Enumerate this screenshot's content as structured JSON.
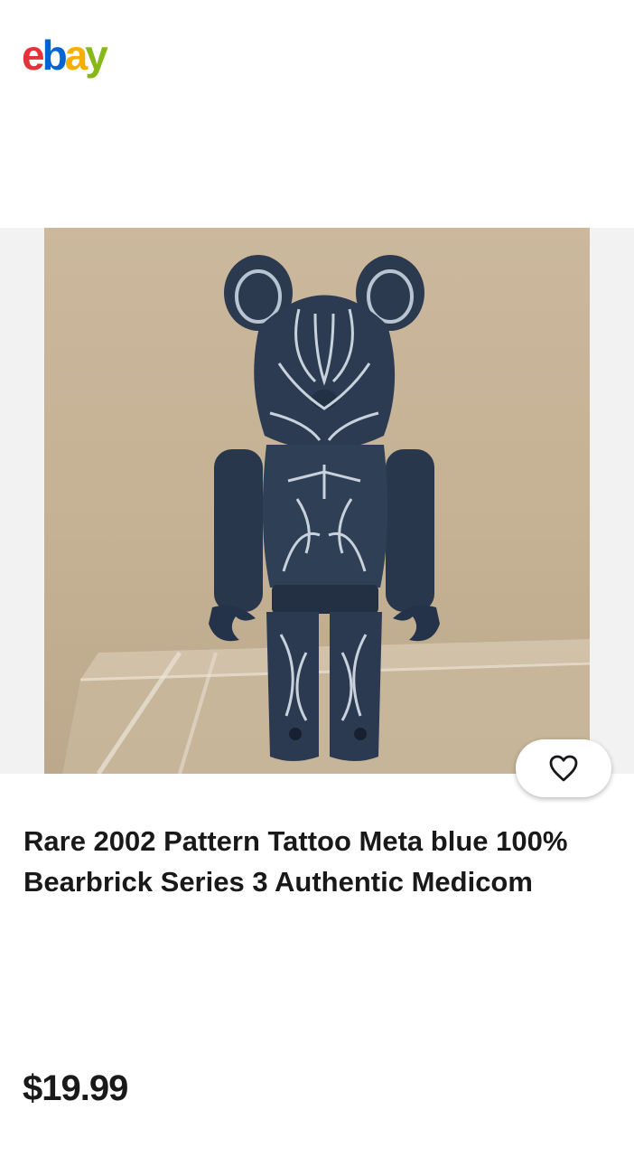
{
  "brand": {
    "logo_letters": [
      "e",
      "b",
      "a",
      "y"
    ],
    "colors": {
      "e": "#e53238",
      "b": "#0064d2",
      "a": "#f5af02",
      "y": "#86b817"
    }
  },
  "listing": {
    "image_alt": "Bearbrick figure with pinstripe tattoo pattern",
    "title": "Rare 2002 Pattern Tattoo Meta blue 100% Bearbrick Series 3 Authentic Medicom",
    "price": "$19.99",
    "watch_icon": "heart-icon"
  }
}
